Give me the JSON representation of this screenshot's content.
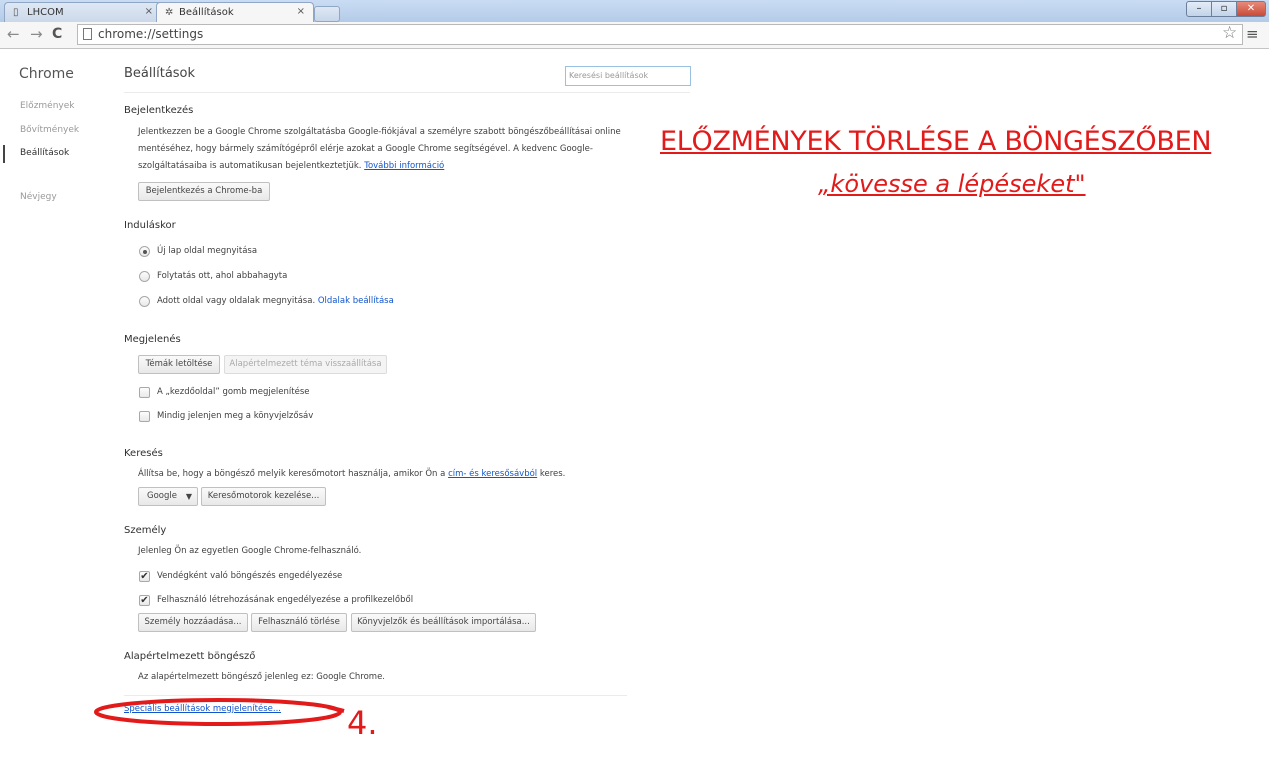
{
  "browser": {
    "tabs": [
      {
        "label": "LHCOM",
        "close": "×"
      },
      {
        "label": "Beállítások",
        "close": "×",
        "icon": "gear-icon"
      }
    ],
    "window_controls": {
      "minimize": "–",
      "maximize": "▫",
      "close": "✕"
    },
    "toolbar": {
      "back": "←",
      "forward": "→",
      "reload": "C",
      "star": "☆",
      "menu": "≡"
    },
    "url": "chrome://settings"
  },
  "sidebar": {
    "brand": "Chrome",
    "items": [
      {
        "label": "Előzmények"
      },
      {
        "label": "Bővítmények"
      },
      {
        "label": "Beállítások",
        "active": true
      },
      {
        "label": "Névjegy"
      }
    ]
  },
  "main": {
    "title": "Beállítások",
    "search_placeholder": "Keresési beállítások",
    "signin": {
      "title": "Bejelentkezés",
      "text_line1": "Jelentkezzen be a Google Chrome szolgáltatásba Google-fiókjával a személyre szabott böngészőbeállításai online",
      "text_line2": "mentéséhez, hogy bármely számítógépről elérje azokat a Google Chrome segítségével. A kedvenc Google-",
      "text_line3": "szolgáltatásaiba is automatikusan bejelentkeztetjük.",
      "learn_more": "További információ",
      "button": "Bejelentkezés a Chrome-ba"
    },
    "startup": {
      "title": "Induláskor",
      "options": [
        "Új lap oldal megnyitása",
        "Folytatás ott, ahol abbahagyta",
        "Adott oldal vagy oldalak megnyitása."
      ],
      "selected_index": 0,
      "pages_link": "Oldalak beállítása"
    },
    "appearance": {
      "title": "Megjelenés",
      "themes_button": "Témák letöltése",
      "reset_theme_button": "Alapértelmezett téma visszaállítása",
      "home_button_option": "A „kezdőoldal” gomb megjelenítése",
      "bookmarks_bar_option": "Mindig jelenjen meg a könyvjelzősáv"
    },
    "search": {
      "title": "Keresés",
      "text_before": "Állítsa be, hogy a böngésző melyik keresőmotort használja, amikor Ön a",
      "omnibox_link": "cím- és keresősávból",
      "text_after": "keres.",
      "engine_select": "Google",
      "engine_arrow": "▼",
      "manage_button": "Keresőmotorok kezelése..."
    },
    "people": {
      "title": "Személy",
      "text": "Jelenleg Ön az egyetlen Google Chrome-felhasználó.",
      "guest_option": "Vendégként való böngészés engedélyezése",
      "create_option": "Felhasználó létrehozásának engedélyezése a profilkezelőből",
      "checkmark": "✔",
      "add_button": "Személy hozzáadása...",
      "remove_button": "Felhasználó törlése",
      "import_button": "Könyvjelzők és beállítások importálása..."
    },
    "default_browser": {
      "title": "Alapértelmezett böngésző",
      "text": "Az alapértelmezett böngésző jelenleg ez: Google Chrome."
    },
    "advanced_link": "Speciális beállítások megjelenítése..."
  },
  "annotation": {
    "title": "ELŐZMÉNYEK TÖRLÉSE A BÖNGÉSZŐBEN",
    "subtitle": "„kövesse a lépéseket\"",
    "step": "4.",
    "color": "#e21a1a"
  }
}
